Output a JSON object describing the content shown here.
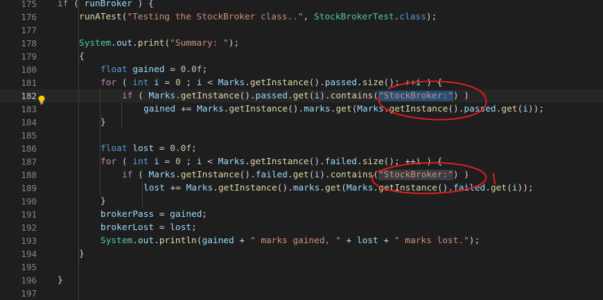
{
  "editor": {
    "lines": [
      {
        "number": "175",
        "tokens": [
          {
            "t": "if",
            "c": "t-cf"
          },
          {
            "t": " ( ",
            "c": "t-pl"
          },
          {
            "t": "runBroker",
            "c": "t-var"
          },
          {
            "t": " ) {",
            "c": "t-pl"
          }
        ]
      },
      {
        "number": "176",
        "tokens": [
          {
            "t": "runATest",
            "c": "t-fn"
          },
          {
            "t": "(",
            "c": "t-pl"
          },
          {
            "t": "\"Testing the StockBroker class..\"",
            "c": "t-str"
          },
          {
            "t": ", ",
            "c": "t-pl"
          },
          {
            "t": "StockBrokerTest",
            "c": "t-cls"
          },
          {
            "t": ".",
            "c": "t-pl"
          },
          {
            "t": "class",
            "c": "t-kw"
          },
          {
            "t": ");",
            "c": "t-pl"
          }
        ]
      },
      {
        "number": "177",
        "tokens": []
      },
      {
        "number": "178",
        "tokens": [
          {
            "t": "System",
            "c": "t-cls"
          },
          {
            "t": ".",
            "c": "t-pl"
          },
          {
            "t": "out",
            "c": "t-var"
          },
          {
            "t": ".",
            "c": "t-pl"
          },
          {
            "t": "print",
            "c": "t-fn"
          },
          {
            "t": "(",
            "c": "t-pl"
          },
          {
            "t": "\"Summary: \"",
            "c": "t-str"
          },
          {
            "t": ");",
            "c": "t-pl"
          }
        ]
      },
      {
        "number": "179",
        "tokens": [
          {
            "t": "{",
            "c": "t-pl"
          }
        ]
      },
      {
        "number": "180",
        "tokens": [
          {
            "t": "float",
            "c": "t-kw"
          },
          {
            "t": " ",
            "c": "t-pl"
          },
          {
            "t": "gained",
            "c": "t-var"
          },
          {
            "t": " = ",
            "c": "t-pl"
          },
          {
            "t": "0.0f",
            "c": "t-num"
          },
          {
            "t": ";",
            "c": "t-pl"
          }
        ]
      },
      {
        "number": "181",
        "tokens": [
          {
            "t": "for",
            "c": "t-cf"
          },
          {
            "t": " ( ",
            "c": "t-pl"
          },
          {
            "t": "int",
            "c": "t-kw"
          },
          {
            "t": " ",
            "c": "t-pl"
          },
          {
            "t": "i",
            "c": "t-var"
          },
          {
            "t": " = ",
            "c": "t-pl"
          },
          {
            "t": "0",
            "c": "t-num"
          },
          {
            "t": " ; ",
            "c": "t-pl"
          },
          {
            "t": "i",
            "c": "t-var"
          },
          {
            "t": " < ",
            "c": "t-pl"
          },
          {
            "t": "Marks",
            "c": "t-var"
          },
          {
            "t": ".",
            "c": "t-pl"
          },
          {
            "t": "getInstance",
            "c": "t-fn"
          },
          {
            "t": "().",
            "c": "t-pl"
          },
          {
            "t": "passed",
            "c": "t-var"
          },
          {
            "t": ".",
            "c": "t-pl"
          },
          {
            "t": "size",
            "c": "t-fn"
          },
          {
            "t": "(); ++",
            "c": "t-pl"
          },
          {
            "t": "i",
            "c": "t-var"
          },
          {
            "t": " ) {",
            "c": "t-pl"
          }
        ]
      },
      {
        "number": "182",
        "current": true,
        "tokens": [
          {
            "t": "if",
            "c": "t-cf"
          },
          {
            "t": " ( ",
            "c": "t-pl"
          },
          {
            "t": "Marks",
            "c": "t-var"
          },
          {
            "t": ".",
            "c": "t-pl"
          },
          {
            "t": "getInstance",
            "c": "t-fn"
          },
          {
            "t": "().",
            "c": "t-pl"
          },
          {
            "t": "passed",
            "c": "t-var"
          },
          {
            "t": ".",
            "c": "t-pl"
          },
          {
            "t": "get",
            "c": "t-fn"
          },
          {
            "t": "(",
            "c": "t-pl"
          },
          {
            "t": "i",
            "c": "t-var"
          },
          {
            "t": ").",
            "c": "t-pl"
          },
          {
            "t": "contains",
            "c": "t-fn"
          },
          {
            "t": "(",
            "c": "t-pl"
          },
          {
            "t": "\"StockBroker:\"",
            "c": "t-str t-sel"
          },
          {
            "t": ") )",
            "c": "t-pl"
          }
        ]
      },
      {
        "number": "183",
        "tokens": [
          {
            "t": "gained",
            "c": "t-var"
          },
          {
            "t": " += ",
            "c": "t-pl"
          },
          {
            "t": "Marks",
            "c": "t-var"
          },
          {
            "t": ".",
            "c": "t-pl"
          },
          {
            "t": "getInstance",
            "c": "t-fn"
          },
          {
            "t": "().",
            "c": "t-pl"
          },
          {
            "t": "marks",
            "c": "t-var"
          },
          {
            "t": ".",
            "c": "t-pl"
          },
          {
            "t": "get",
            "c": "t-fn"
          },
          {
            "t": "(",
            "c": "t-pl"
          },
          {
            "t": "Marks",
            "c": "t-var"
          },
          {
            "t": ".",
            "c": "t-pl"
          },
          {
            "t": "getInstance",
            "c": "t-fn"
          },
          {
            "t": "().",
            "c": "t-pl"
          },
          {
            "t": "passed",
            "c": "t-var"
          },
          {
            "t": ".",
            "c": "t-pl"
          },
          {
            "t": "get",
            "c": "t-fn"
          },
          {
            "t": "(",
            "c": "t-pl"
          },
          {
            "t": "i",
            "c": "t-var"
          },
          {
            "t": "));",
            "c": "t-pl"
          }
        ]
      },
      {
        "number": "184",
        "tokens": [
          {
            "t": "}",
            "c": "t-pl"
          }
        ]
      },
      {
        "number": "185",
        "tokens": []
      },
      {
        "number": "186",
        "tokens": [
          {
            "t": "float",
            "c": "t-kw"
          },
          {
            "t": " ",
            "c": "t-pl"
          },
          {
            "t": "lost",
            "c": "t-var"
          },
          {
            "t": " = ",
            "c": "t-pl"
          },
          {
            "t": "0.0f",
            "c": "t-num"
          },
          {
            "t": ";",
            "c": "t-pl"
          }
        ]
      },
      {
        "number": "187",
        "tokens": [
          {
            "t": "for",
            "c": "t-cf"
          },
          {
            "t": " ( ",
            "c": "t-pl"
          },
          {
            "t": "int",
            "c": "t-kw"
          },
          {
            "t": " ",
            "c": "t-pl"
          },
          {
            "t": "i",
            "c": "t-var"
          },
          {
            "t": " = ",
            "c": "t-pl"
          },
          {
            "t": "0",
            "c": "t-num"
          },
          {
            "t": " ; ",
            "c": "t-pl"
          },
          {
            "t": "i",
            "c": "t-var"
          },
          {
            "t": " < ",
            "c": "t-pl"
          },
          {
            "t": "Marks",
            "c": "t-var"
          },
          {
            "t": ".",
            "c": "t-pl"
          },
          {
            "t": "getInstance",
            "c": "t-fn"
          },
          {
            "t": "().",
            "c": "t-pl"
          },
          {
            "t": "failed",
            "c": "t-var"
          },
          {
            "t": ".",
            "c": "t-pl"
          },
          {
            "t": "size",
            "c": "t-fn"
          },
          {
            "t": "(); ++",
            "c": "t-pl"
          },
          {
            "t": "i",
            "c": "t-var"
          },
          {
            "t": " ) {",
            "c": "t-pl"
          }
        ]
      },
      {
        "number": "188",
        "tokens": [
          {
            "t": "if",
            "c": "t-cf"
          },
          {
            "t": " ( ",
            "c": "t-pl"
          },
          {
            "t": "Marks",
            "c": "t-var"
          },
          {
            "t": ".",
            "c": "t-pl"
          },
          {
            "t": "getInstance",
            "c": "t-fn"
          },
          {
            "t": "().",
            "c": "t-pl"
          },
          {
            "t": "failed",
            "c": "t-var"
          },
          {
            "t": ".",
            "c": "t-pl"
          },
          {
            "t": "get",
            "c": "t-fn"
          },
          {
            "t": "(",
            "c": "t-pl"
          },
          {
            "t": "i",
            "c": "t-var"
          },
          {
            "t": ").",
            "c": "t-pl"
          },
          {
            "t": "contains",
            "c": "t-fn"
          },
          {
            "t": "(",
            "c": "t-pl"
          },
          {
            "t": "\"StockBroker:\"",
            "c": "t-str t-hl"
          },
          {
            "t": ") )",
            "c": "t-pl"
          }
        ]
      },
      {
        "number": "189",
        "tokens": [
          {
            "t": "lost",
            "c": "t-var"
          },
          {
            "t": " += ",
            "c": "t-pl"
          },
          {
            "t": "Marks",
            "c": "t-var"
          },
          {
            "t": ".",
            "c": "t-pl"
          },
          {
            "t": "getInstance",
            "c": "t-fn"
          },
          {
            "t": "().",
            "c": "t-pl"
          },
          {
            "t": "marks",
            "c": "t-var"
          },
          {
            "t": ".",
            "c": "t-pl"
          },
          {
            "t": "get",
            "c": "t-fn"
          },
          {
            "t": "(",
            "c": "t-pl"
          },
          {
            "t": "Marks",
            "c": "t-var"
          },
          {
            "t": ".",
            "c": "t-pl"
          },
          {
            "t": "getInstance",
            "c": "t-fn"
          },
          {
            "t": "().",
            "c": "t-pl"
          },
          {
            "t": "failed",
            "c": "t-var"
          },
          {
            "t": ".",
            "c": "t-pl"
          },
          {
            "t": "get",
            "c": "t-fn"
          },
          {
            "t": "(",
            "c": "t-pl"
          },
          {
            "t": "i",
            "c": "t-var"
          },
          {
            "t": "));",
            "c": "t-pl"
          }
        ]
      },
      {
        "number": "190",
        "tokens": [
          {
            "t": "}",
            "c": "t-pl"
          }
        ]
      },
      {
        "number": "191",
        "tokens": [
          {
            "t": "brokerPass",
            "c": "t-var"
          },
          {
            "t": " = ",
            "c": "t-pl"
          },
          {
            "t": "gained",
            "c": "t-var"
          },
          {
            "t": ";",
            "c": "t-pl"
          }
        ]
      },
      {
        "number": "192",
        "tokens": [
          {
            "t": "brokerLost",
            "c": "t-var"
          },
          {
            "t": " = ",
            "c": "t-pl"
          },
          {
            "t": "lost",
            "c": "t-var"
          },
          {
            "t": ";",
            "c": "t-pl"
          }
        ]
      },
      {
        "number": "193",
        "tokens": [
          {
            "t": "System",
            "c": "t-cls"
          },
          {
            "t": ".",
            "c": "t-pl"
          },
          {
            "t": "out",
            "c": "t-var"
          },
          {
            "t": ".",
            "c": "t-pl"
          },
          {
            "t": "println",
            "c": "t-fn"
          },
          {
            "t": "(",
            "c": "t-pl"
          },
          {
            "t": "gained",
            "c": "t-var"
          },
          {
            "t": " + ",
            "c": "t-pl"
          },
          {
            "t": "\" marks gained, \"",
            "c": "t-str"
          },
          {
            "t": " + ",
            "c": "t-pl"
          },
          {
            "t": "lost",
            "c": "t-var"
          },
          {
            "t": " + ",
            "c": "t-pl"
          },
          {
            "t": "\" marks lost.\"",
            "c": "t-str"
          },
          {
            "t": ");",
            "c": "t-pl"
          }
        ]
      },
      {
        "number": "194",
        "tokens": [
          {
            "t": "}",
            "c": "t-pl"
          }
        ]
      },
      {
        "number": "195",
        "tokens": []
      },
      {
        "number": "196",
        "tokens": [
          {
            "t": "}",
            "c": "t-pl"
          }
        ]
      },
      {
        "number": "197",
        "tokens": []
      }
    ],
    "lightbulb_icon": "lightbulb-icon",
    "annotation_color": "#e0201c"
  }
}
